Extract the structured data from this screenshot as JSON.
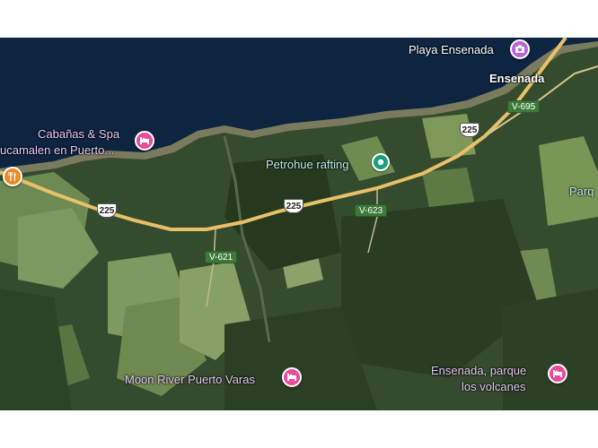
{
  "map": {
    "colors": {
      "lake": "#0d2540",
      "forest": "#2f4429",
      "field": "#6d8a52",
      "road": "#e8c06a"
    },
    "places": {
      "playa": "Playa Ensenada",
      "ensenada": "Ensenada",
      "cabanas_line1": "Cabañas & Spa",
      "cabanas_line2": "ucamalen en Puerto...",
      "petrohue": "Petrohue rafting",
      "parque_partial": "Parq",
      "moon_river": "Moon River Puerto Varas",
      "ensenada_parque_line1": "Ensenada, parque",
      "ensenada_parque_line2": "los volcanes"
    },
    "roads": {
      "shield_a": "225",
      "shield_b": "225",
      "shield_c": "225",
      "v695": "V-695",
      "v623": "V-623",
      "v621": "V-621"
    },
    "icons": {
      "hotel": "hotel-pin-icon",
      "food": "restaurant-pin-icon",
      "camera": "camera-pin-icon",
      "poi": "poi-pin-icon"
    }
  }
}
